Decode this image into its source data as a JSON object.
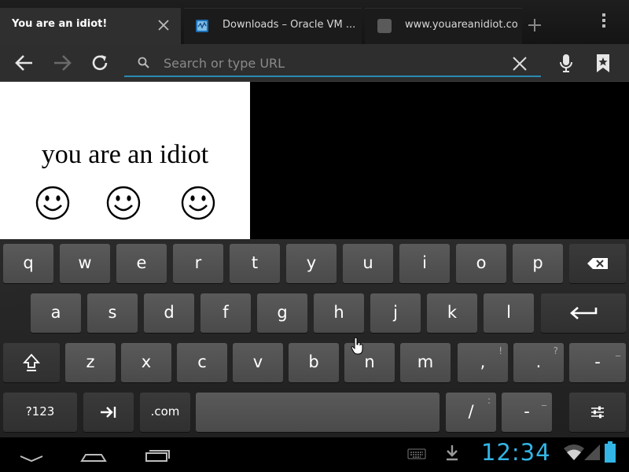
{
  "browser": {
    "tabs": [
      {
        "title": "You are an idiot!",
        "active": true
      },
      {
        "title": "Downloads – Oracle VM ...",
        "active": false
      },
      {
        "title": "www.youareanidiot.co",
        "active": false
      }
    ],
    "url_placeholder": "Search or type URL"
  },
  "webpage": {
    "heading": "you are an idiot",
    "smiley_count": 3
  },
  "keyboard": {
    "row1": [
      "q",
      "w",
      "e",
      "r",
      "t",
      "y",
      "u",
      "i",
      "o",
      "p"
    ],
    "row2": [
      "a",
      "s",
      "d",
      "f",
      "g",
      "h",
      "j",
      "k",
      "l"
    ],
    "row3": [
      "z",
      "x",
      "c",
      "v",
      "b",
      "n",
      "m"
    ],
    "comma": ",",
    "comma_hint": "!",
    "period": ".",
    "period_hint": "?",
    "dash": "-",
    "dash_hint": "_",
    "symbols_label": "?123",
    "dotcom_label": ".com",
    "slash": "/",
    "slash_hint": ":",
    "dash2": "-",
    "dash2_hint": "_"
  },
  "status": {
    "time": "12:34",
    "accent_color": "#33b5e5"
  }
}
